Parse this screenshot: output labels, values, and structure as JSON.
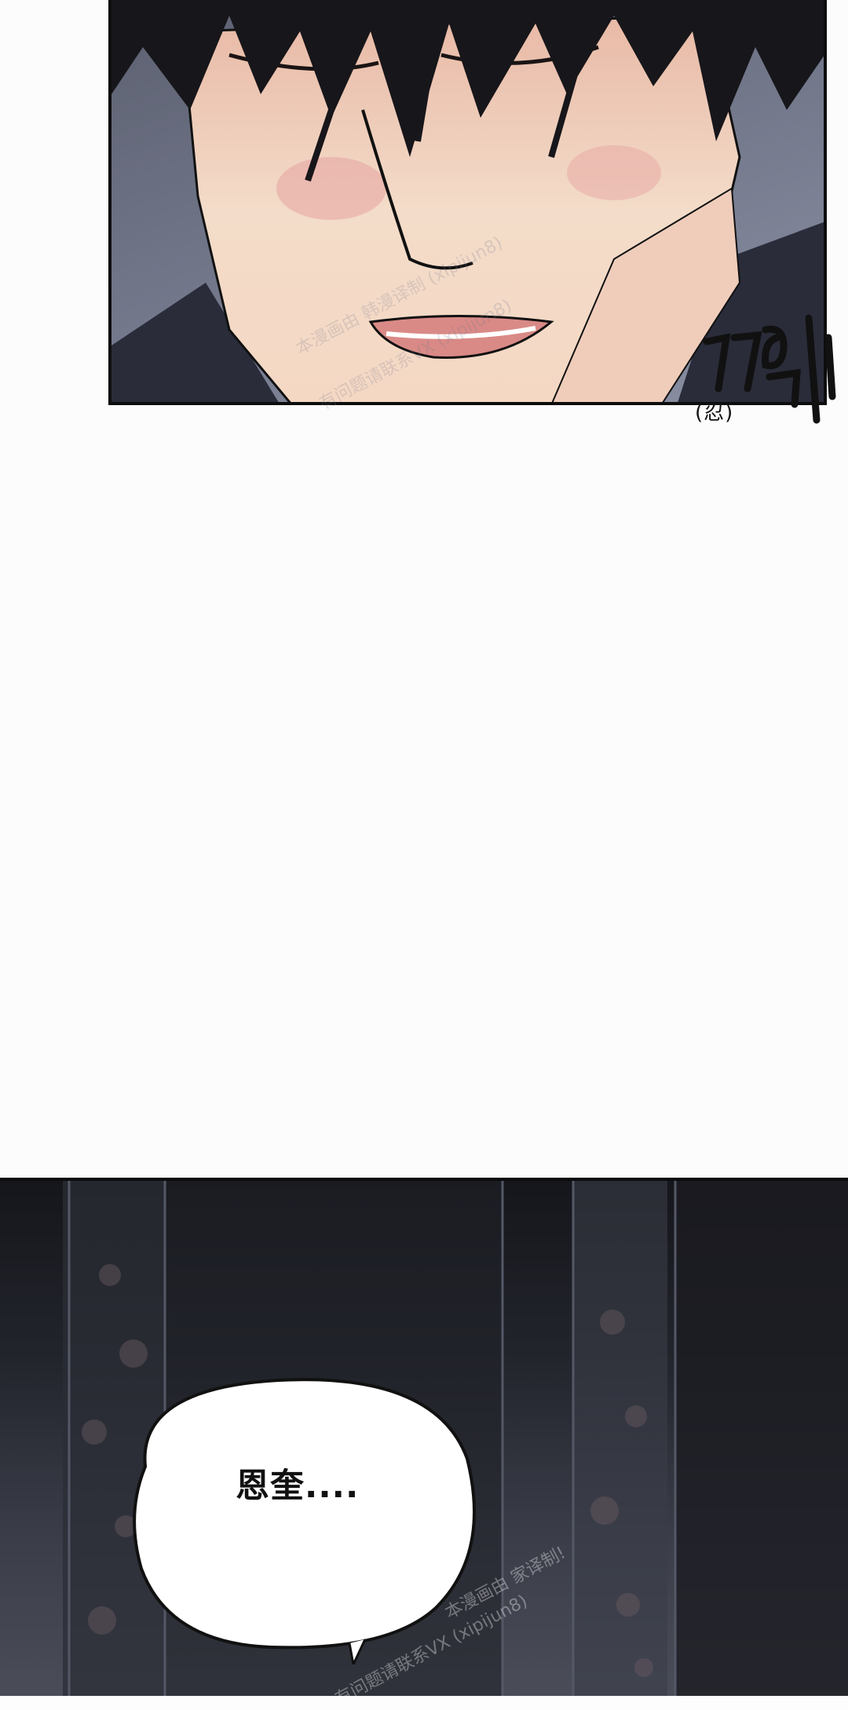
{
  "top_panel": {
    "sfx_main": "끄윽",
    "sfx_translation": "(忍)"
  },
  "bottom_panel": {
    "speech": "恩奎...."
  },
  "watermarks": [
    "本漫画由 韩漫译制 (xipijun8)",
    "有问题请联系VX (xipijun8)",
    "本漫画由 家译制!",
    "有问题请联系VX (xipijun8)"
  ],
  "colors": {
    "panel_border": "#0d0d0d",
    "skin": "#f1d7c4",
    "hair": "#17161a",
    "night_background": "#23252d",
    "bubble_fill": "#ffffff"
  }
}
